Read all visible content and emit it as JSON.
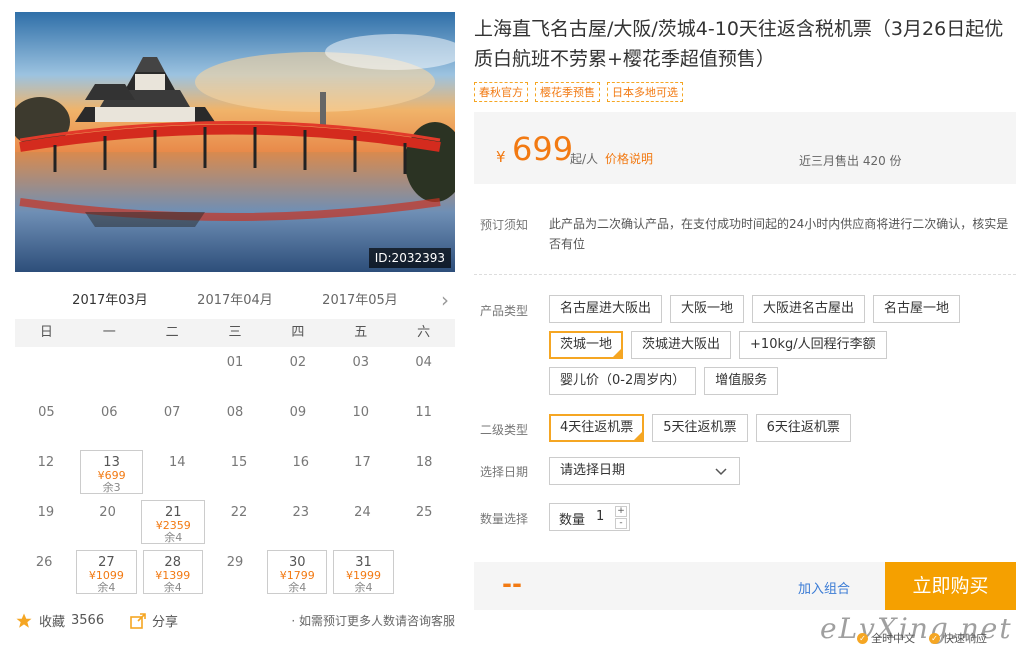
{
  "product": {
    "image_id": "ID:2032393",
    "title": "上海直飞名古屋/大阪/茨城4-10天往返含税机票（3月26日起优质白航班不劳累+樱花季超值预售）",
    "tags": [
      "春秋官方",
      "樱花季预售",
      "日本多地可选"
    ]
  },
  "price": {
    "currency": "¥",
    "amount": "699",
    "unit": "起/人",
    "explain_link": "价格说明",
    "sold": "近三月售出 420 份"
  },
  "notice": {
    "label": "预订须知",
    "text": "此产品为二次确认产品，在支付成功时间起的24小时内供应商将进行二次确认，核实是否有位"
  },
  "product_type": {
    "label": "产品类型",
    "options": [
      "名古屋进大阪出",
      "大阪一地",
      "大阪进名古屋出",
      "名古屋一地",
      "茨城一地",
      "茨城进大阪出",
      "+10kg/人回程行李额",
      "婴儿价（0-2周岁内）",
      "增值服务"
    ],
    "selected": "茨城一地"
  },
  "sub_type": {
    "label": "二级类型",
    "options": [
      "4天往返机票",
      "5天往返机票",
      "6天往返机票"
    ],
    "selected": "4天往返机票"
  },
  "date": {
    "label": "选择日期",
    "placeholder": "请选择日期"
  },
  "quantity": {
    "label": "数量选择",
    "field_label": "数量",
    "value": "1",
    "plus": "+",
    "minus": "-"
  },
  "buy": {
    "total": "--",
    "add_combo": "加入组合",
    "buy_now": "立即购买"
  },
  "calendar": {
    "tabs": [
      "2017年03月",
      "2017年04月",
      "2017年05月"
    ],
    "active_tab": "2017年03月",
    "next": "›",
    "weekdays": [
      "日",
      "一",
      "二",
      "三",
      "四",
      "五",
      "六"
    ],
    "weeks": [
      [
        {
          "d": ""
        },
        {
          "d": ""
        },
        {
          "d": ""
        },
        {
          "d": "01"
        },
        {
          "d": "02"
        },
        {
          "d": "03"
        },
        {
          "d": "04"
        }
      ],
      [
        {
          "d": "05"
        },
        {
          "d": "06"
        },
        {
          "d": "07"
        },
        {
          "d": "08"
        },
        {
          "d": "09"
        },
        {
          "d": "10"
        },
        {
          "d": "11"
        }
      ],
      [
        {
          "d": "12"
        },
        {
          "d": "13",
          "p": "¥699",
          "s": "余3"
        },
        {
          "d": "14"
        },
        {
          "d": "15"
        },
        {
          "d": "16"
        },
        {
          "d": "17"
        },
        {
          "d": "18"
        }
      ],
      [
        {
          "d": "19"
        },
        {
          "d": "20"
        },
        {
          "d": "21",
          "p": "¥2359",
          "s": "余4"
        },
        {
          "d": "22"
        },
        {
          "d": "23"
        },
        {
          "d": "24"
        },
        {
          "d": "25"
        }
      ],
      [
        {
          "d": "26"
        },
        {
          "d": "27",
          "p": "¥1099",
          "s": "余4"
        },
        {
          "d": "28",
          "p": "¥1399",
          "s": "余4"
        },
        {
          "d": "29"
        },
        {
          "d": "30",
          "p": "¥1799",
          "s": "余4"
        },
        {
          "d": "31",
          "p": "¥1999",
          "s": "余4"
        },
        {
          "d": ""
        }
      ]
    ]
  },
  "footer_left": {
    "favorite_label": "收藏",
    "favorite_count": "3566",
    "share_label": "分享",
    "note": "· 如需预订更多人数请咨询客服"
  },
  "watermark": "eLvXing.net",
  "guarantees": [
    "全时中文",
    "快速响应"
  ],
  "colors": {
    "accent": "#f5a623",
    "price": "#f27a13",
    "buy": "#f5a000",
    "link": "#3a7bd5"
  }
}
